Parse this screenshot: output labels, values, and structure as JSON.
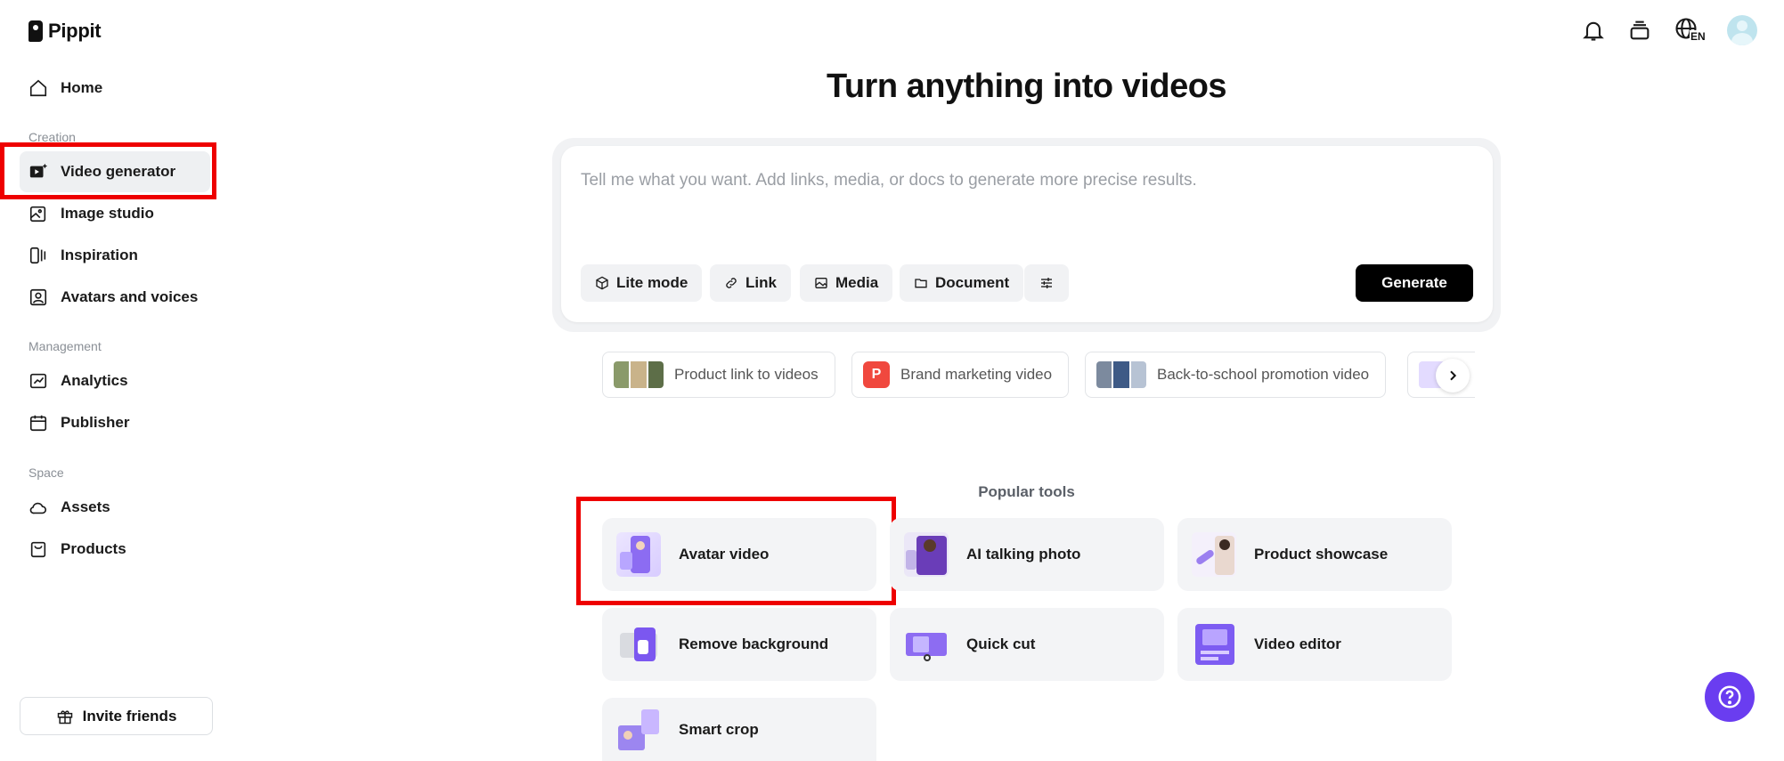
{
  "app": {
    "name": "Pippit"
  },
  "sidebar": {
    "home": "Home",
    "sections": {
      "creation": "Creation",
      "management": "Management",
      "space": "Space"
    },
    "items": [
      {
        "label": "Video generator"
      },
      {
        "label": "Image studio"
      },
      {
        "label": "Inspiration"
      },
      {
        "label": "Avatars and voices"
      },
      {
        "label": "Analytics"
      },
      {
        "label": "Publisher"
      },
      {
        "label": "Assets"
      },
      {
        "label": "Products"
      }
    ],
    "invite": "Invite friends"
  },
  "topbar": {
    "language": "EN"
  },
  "main": {
    "headline": "Turn anything into videos",
    "prompt_placeholder": "Tell me what you want. Add links, media, or docs to generate more precise results.",
    "chips": [
      "Lite mode",
      "Link",
      "Media",
      "Document"
    ],
    "generate": "Generate",
    "suggestions": [
      "Product link to videos",
      "Brand marketing video",
      "Back-to-school promotion video"
    ],
    "brand_badge": "P",
    "popular_label": "Popular tools",
    "tools": [
      "Avatar video",
      "AI talking photo",
      "Product showcase",
      "Remove background",
      "Quick cut",
      "Video editor",
      "Smart crop"
    ]
  },
  "colors": {
    "accent_purple": "#6a3df0",
    "highlight_red": "#ee0000",
    "generate_bg": "#000000",
    "brand_badge": "#f0483e"
  }
}
